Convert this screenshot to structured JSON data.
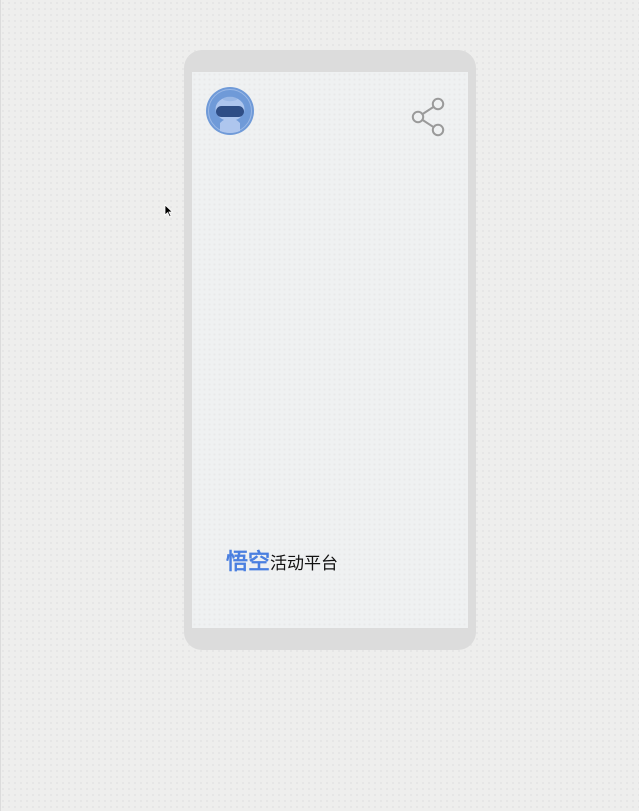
{
  "app": {
    "brand_main": "悟空",
    "brand_sub": "活动平台"
  },
  "header": {
    "avatar_icon": "robot-avatar-icon",
    "share_icon": "share-icon"
  },
  "colors": {
    "brand_accent": "#4a7fe0",
    "avatar_bg": "#6f9ad8",
    "icon_gray": "#9a9a9a"
  }
}
